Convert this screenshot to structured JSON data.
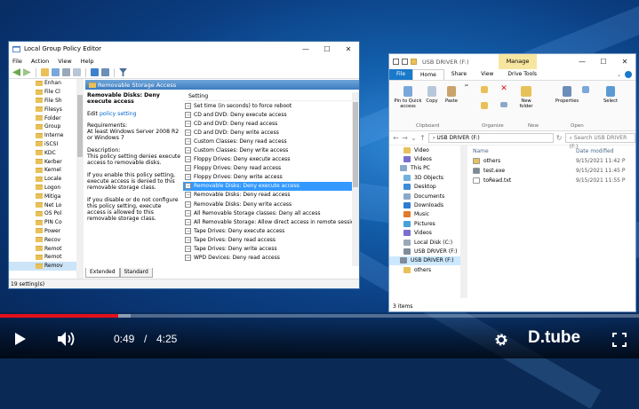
{
  "gpe": {
    "title": "Local Group Policy Editor",
    "menu": [
      "File",
      "Action",
      "View",
      "Help"
    ],
    "tree": [
      "Enhan",
      "File Cl",
      "File Sh",
      "Filesys",
      "Folder",
      "Group",
      "Interne",
      "iSCSI",
      "KDC",
      "Kerber",
      "Kernel",
      "Locale",
      "Logon",
      "Mitiga",
      "Net Lo",
      "OS Pol",
      "PIN Co",
      "Power",
      "Recov",
      "Remot",
      "Remot",
      "Remov"
    ],
    "panel_header": "Removable Storage Access",
    "desc": {
      "title": "Removable Disks: Deny execute access",
      "edit_prefix": "Edit ",
      "edit_link": "policy setting",
      "requirements": "Requirements:\nAt least Windows Server 2008 R2 or Windows 7",
      "description": "Description:\nThis policy setting denies execute access to removable disks.",
      "enabled": "If you enable this policy setting, execute access is denied to this removable storage class.",
      "disabled": "If you disable or do not configure this policy setting, execute access is allowed to this removable storage class."
    },
    "settings_header": "Setting",
    "settings": [
      "Set time (in seconds) to force reboot",
      "CD and DVD: Deny execute access",
      "CD and DVD: Deny read access",
      "CD and DVD: Deny write access",
      "Custom Classes: Deny read access",
      "Custom Classes: Deny write access",
      "Floppy Drives: Deny execute access",
      "Floppy Drives: Deny read access",
      "Floppy Drives: Deny write access",
      "Removable Disks: Deny execute access",
      "Removable Disks: Deny read access",
      "Removable Disks: Deny write access",
      "All Removable Storage classes: Deny all access",
      "All Removable Storage: Allow direct access in remote sessions",
      "Tape Drives: Deny execute access",
      "Tape Drives: Deny read access",
      "Tape Drives: Deny write access",
      "WPD Devices: Deny read access"
    ],
    "selected_setting_index": 9,
    "tabs": [
      "Extended",
      "Standard"
    ],
    "status": "19 setting(s)"
  },
  "explorer": {
    "title": "USB DRIVER (F:)",
    "manage_tab": "Manage",
    "ribbon_tabs": [
      "File",
      "Home",
      "Share",
      "View",
      "Drive Tools"
    ],
    "ribbon_buttons": {
      "pin": "Pin to Quick access",
      "copy": "Copy",
      "paste": "Paste",
      "new_folder": "New folder",
      "properties": "Properties",
      "select": "Select"
    },
    "ribbon_groups": [
      "Clipboard",
      "Organize",
      "New",
      "Open"
    ],
    "address": "USB DRIVER (F:)",
    "search_placeholder": "Search USB DRIVER (F:)",
    "nav": [
      "Video",
      "Videos",
      "This PC",
      "3D Objects",
      "Desktop",
      "Documents",
      "Downloads",
      "Music",
      "Pictures",
      "Videos",
      "Local Disk (C:)",
      "USB DRIVER (F:)",
      "USB DRIVER (F:)",
      "others"
    ],
    "nav_selected_index": 12,
    "columns": [
      "Name",
      "Date modified"
    ],
    "files": [
      {
        "name": "others",
        "date": "9/15/2021 11:42 P"
      },
      {
        "name": "test.exe",
        "date": "9/15/2021 11:45 P"
      },
      {
        "name": "toRead.txt",
        "date": "9/15/2021 11:55 P"
      }
    ],
    "status": "3 items"
  },
  "player": {
    "current_time": "0:49",
    "separator": "/",
    "duration": "4:25",
    "progress_fraction": 0.185,
    "buffered_fraction": 0.205,
    "brand": "D.tube"
  },
  "colors": {
    "progress_red": "#e4101a",
    "selection_blue": "#3399ff",
    "manage_tab": "#f7e6a0"
  }
}
